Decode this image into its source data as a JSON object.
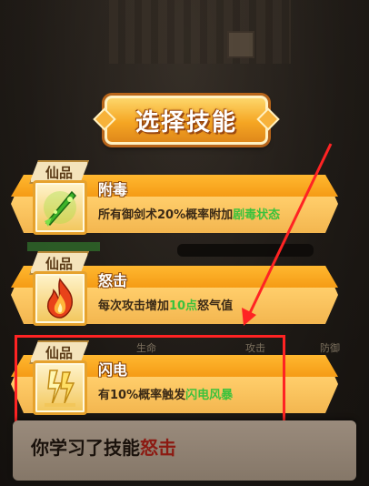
{
  "title": "选择技能",
  "cards": [
    {
      "grade": "仙品",
      "name": "附毒",
      "icon": "poison-sword-icon",
      "desc_prefix": "所有御剑术20%概率附加",
      "desc_highlight": "剧毒状态",
      "desc_suffix": ""
    },
    {
      "grade": "仙品",
      "name": "怒击",
      "icon": "flame-icon",
      "desc_prefix": "每次攻击增加",
      "desc_highlight": "10点",
      "desc_suffix": "怒气值"
    },
    {
      "grade": "仙品",
      "name": "闪电",
      "icon": "lightning-icon",
      "desc_prefix": "有10%概率触发",
      "desc_highlight": "闪电风暴",
      "desc_suffix": ""
    }
  ],
  "background_labels": {
    "label_1": "生命",
    "label_2": "攻击",
    "label_3": "防御"
  },
  "notice": {
    "prefix": "你学习了技能",
    "skill": "怒击"
  },
  "colors": {
    "highlight": "#3cc23c",
    "selection_box": "#ff2323",
    "notice_skill": "#8c1a12"
  }
}
